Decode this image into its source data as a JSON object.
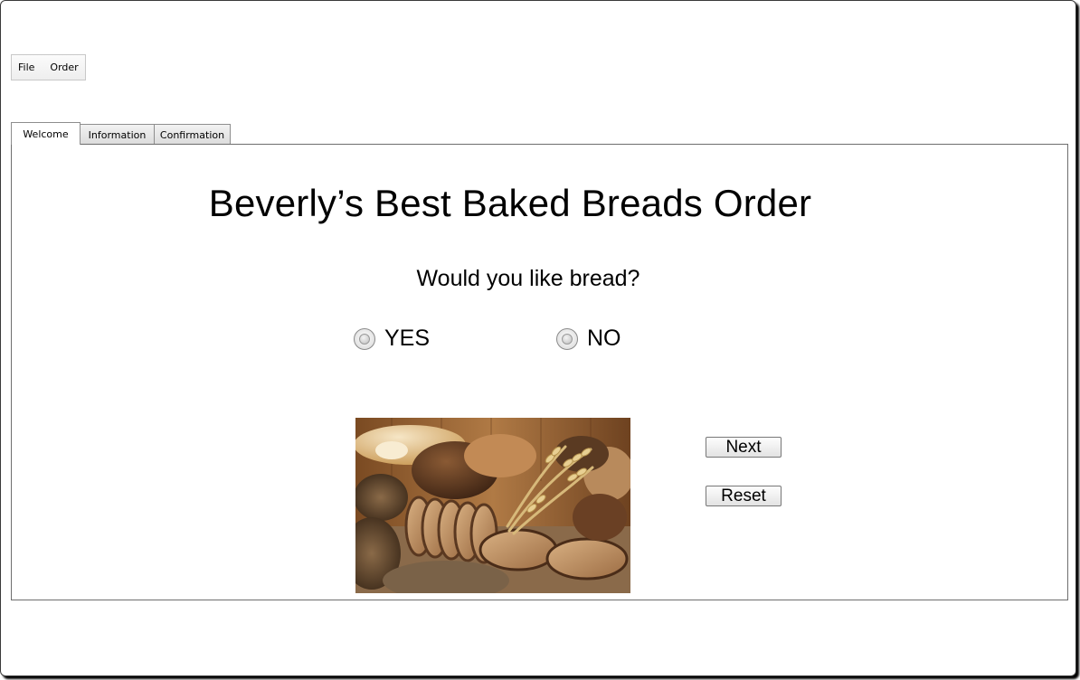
{
  "menu": {
    "items": [
      "File",
      "Order"
    ]
  },
  "tabs": [
    "Welcome",
    "Information",
    "Confirmation"
  ],
  "main": {
    "title": "Beverly’s Best Baked Breads Order",
    "question": "Would you like bread?",
    "options": [
      "YES",
      "NO"
    ],
    "buttons": {
      "next": "Next",
      "reset": "Reset"
    }
  },
  "image": {
    "subject": "assorted breads with wheat stalks"
  }
}
